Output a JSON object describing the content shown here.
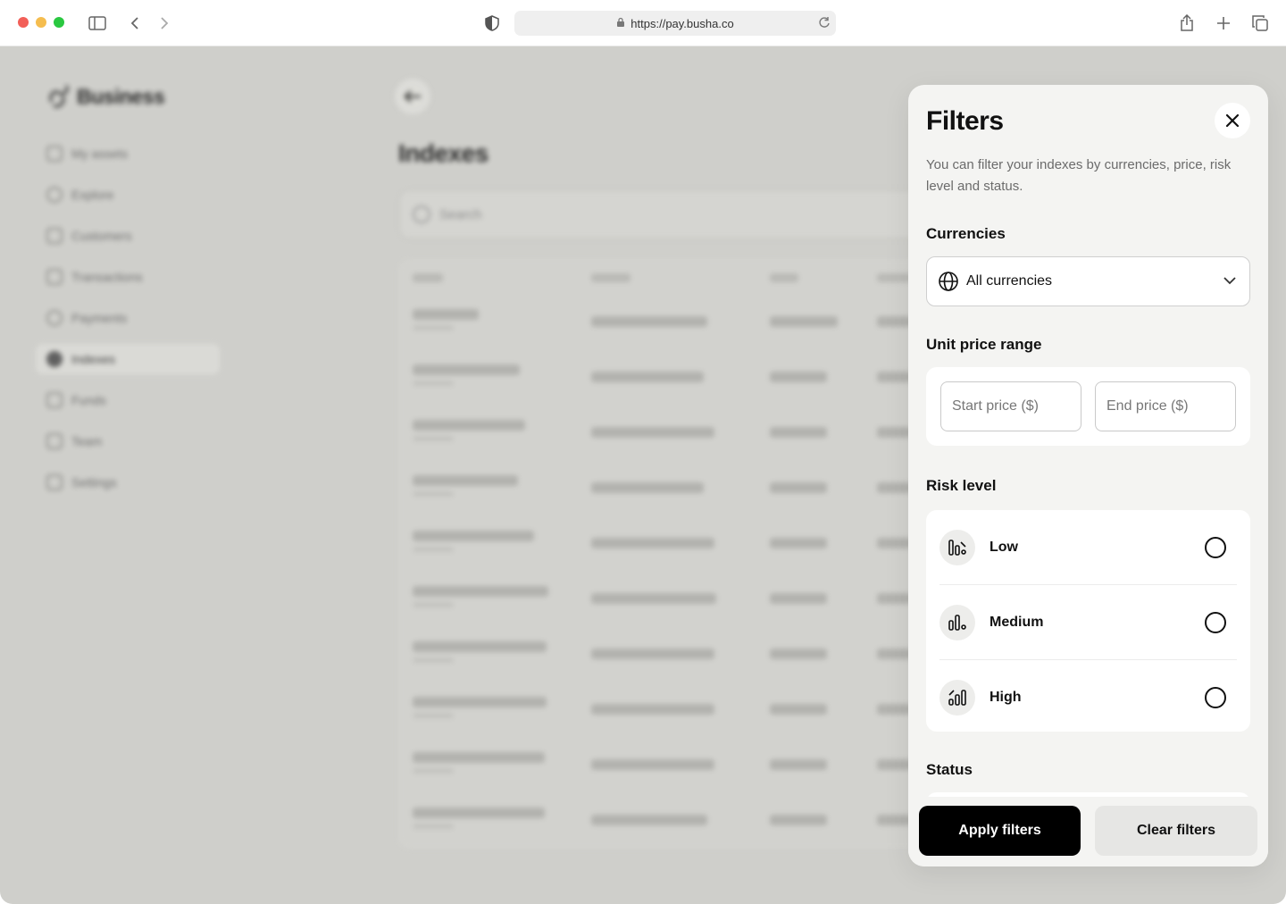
{
  "browser": {
    "url": "https://pay.busha.co"
  },
  "app": {
    "logo_text": "Business",
    "sidebar": {
      "items": [
        {
          "label": "My assets"
        },
        {
          "label": "Explore"
        },
        {
          "label": "Customers"
        },
        {
          "label": "Transactions"
        },
        {
          "label": "Payments"
        },
        {
          "label": "Indexes"
        },
        {
          "label": "Funds"
        },
        {
          "label": "Team"
        },
        {
          "label": "Settings"
        }
      ]
    },
    "page_title": "Indexes",
    "search_placeholder": "Search",
    "table": {
      "headers": [
        "Index",
        "Assets",
        "NAV",
        "Ret"
      ]
    }
  },
  "filters": {
    "title": "Filters",
    "description": "You can filter your indexes by currencies, price, risk level and status.",
    "currencies": {
      "label": "Currencies",
      "selected": "All currencies"
    },
    "price": {
      "label": "Unit price range",
      "start_placeholder": "Start price ($)",
      "end_placeholder": "End price ($)"
    },
    "risk": {
      "label": "Risk level",
      "options": [
        {
          "label": "Low",
          "icon": "low-risk-icon"
        },
        {
          "label": "Medium",
          "icon": "medium-risk-icon"
        },
        {
          "label": "High",
          "icon": "high-risk-icon"
        }
      ]
    },
    "status": {
      "label": "Status"
    },
    "apply_label": "Apply filters",
    "clear_label": "Clear filters"
  }
}
